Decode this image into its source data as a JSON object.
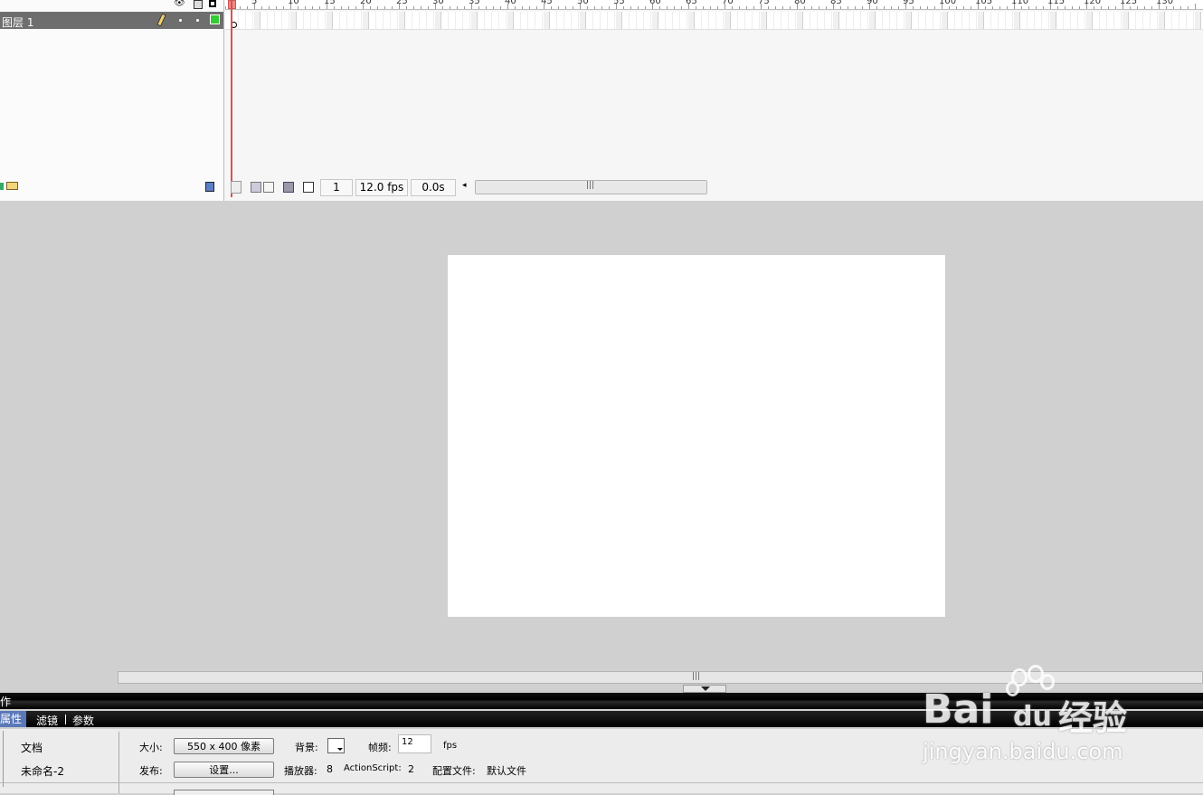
{
  "timeline": {
    "layer_name": "图层 1",
    "ruler_ticks": [
      "5",
      "10",
      "15",
      "20",
      "25",
      "30",
      "35",
      "40",
      "45",
      "50",
      "55",
      "60",
      "65",
      "70",
      "75",
      "80",
      "85",
      "90",
      "95",
      "100",
      "105",
      "110",
      "115",
      "120",
      "125",
      "130"
    ],
    "current_frame": "1",
    "frame_rate": "12.0 fps",
    "elapsed_time": "0.0s"
  },
  "panels": {
    "actions_title": "动作",
    "tabs": [
      "属性",
      "滤镜",
      "参数"
    ]
  },
  "properties": {
    "doc_type": "文档",
    "doc_name": "未命名-2",
    "size_label": "大小:",
    "size_value": "550 x 400 像素",
    "background_label": "背景:",
    "framerate_label": "帧频:",
    "framerate_value": "12",
    "fps_unit": "fps",
    "publish_label": "发布:",
    "settings_button": "设置...",
    "player_label": "播放器:",
    "player_value": "8",
    "as_label": "ActionScript:",
    "as_value": "2",
    "profile_label": "配置文件:",
    "profile_value": "默认文件"
  },
  "watermark": {
    "brand": "Bai",
    "brand2": "du",
    "cn": "经验",
    "url": "jingyan.baidu.com"
  },
  "colors": {
    "stage_bg": "#ffffff",
    "workspace_bg": "#d0d0d0",
    "layer_row": "#6e6e6e",
    "playhead": "#d9534f",
    "layer_color_box": "#33cc33"
  }
}
